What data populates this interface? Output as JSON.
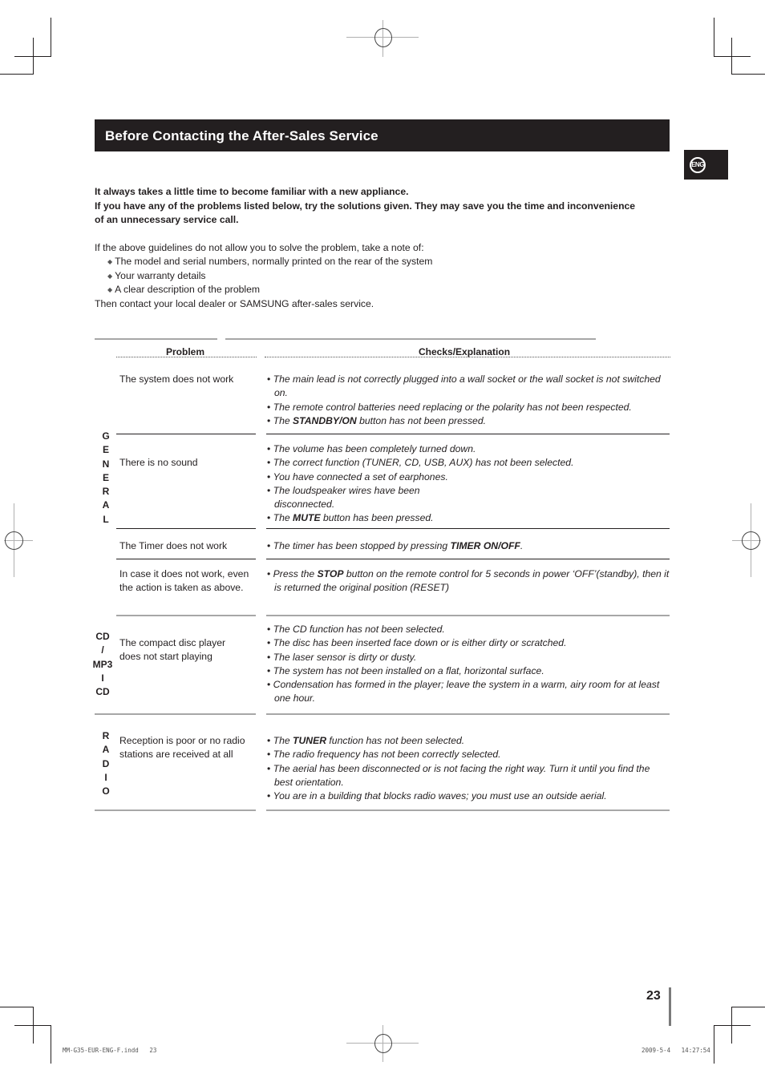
{
  "header": {
    "title": "Before Contacting the After-Sales Service",
    "language_badge": "ENG"
  },
  "intro": {
    "lines": [
      "It always takes a little time to become familiar with a new appliance.",
      "If you have any of the problems listed below, try the solutions given. They may save you the time and inconvenience of an unnecessary service call."
    ]
  },
  "notes": {
    "lead": "If the above guidelines do not allow you to solve the problem, take a note of:",
    "bullets": [
      "The model and serial numbers, normally printed on the rear of the system",
      "Your warranty details",
      "A clear description of the problem"
    ],
    "closing": "Then contact your local dealer or SAMSUNG after-sales service."
  },
  "table": {
    "columns": [
      "Problem",
      "Checks/Explanation"
    ],
    "categories": {
      "general": "G\nE\nN\nE\nR\nA\nL",
      "cd": "CD\n/\nMP3\nI\nCD",
      "radio": "R\nA\nD\nI\nO"
    },
    "rows": [
      {
        "category": "general",
        "problem": "The system does not work",
        "checks": [
          {
            "pre": "The main lead is not correctly plugged into a wall socket or the wall socket is not switched on.",
            "bold": "",
            "post": ""
          },
          {
            "pre": "The remote control batteries need replacing or the polarity has not been respected.",
            "bold": "",
            "post": ""
          },
          {
            "pre": "The ",
            "bold": "STANDBY/ON",
            "post": " button has not been pressed."
          }
        ]
      },
      {
        "category": "general",
        "problem": "There is no sound",
        "checks": [
          {
            "pre": "The volume has been completely turned down.",
            "bold": "",
            "post": ""
          },
          {
            "pre": "The correct function (TUNER, CD, USB, AUX) has not been selected.",
            "bold": "",
            "post": ""
          },
          {
            "pre": "You have connected a set of earphones.",
            "bold": "",
            "post": ""
          },
          {
            "pre": "The loudspeaker wires have been disconnected.",
            "bold": "",
            "post": ""
          },
          {
            "pre": "The ",
            "bold": "MUTE",
            "post": " button has been pressed."
          }
        ]
      },
      {
        "category": "general",
        "problem": "The Timer does not work",
        "checks": [
          {
            "pre": "The timer has been stopped by pressing ",
            "bold": "TIMER ON/OFF",
            "post": "."
          }
        ]
      },
      {
        "category": "general",
        "problem": "In case it does not work, even the action is taken as above.",
        "checks": [
          {
            "pre": "Press the ",
            "bold": "STOP",
            "post": " button on the remote control for 5 seconds in power ‘OFF’(standby), then it is returned the original position (RESET)"
          }
        ]
      },
      {
        "category": "cd",
        "problem": "The compact disc player does not start playing",
        "checks": [
          {
            "pre": "The CD function has not been selected.",
            "bold": "",
            "post": ""
          },
          {
            "pre": "The disc has been inserted face down or is either dirty or scratched.",
            "bold": "",
            "post": ""
          },
          {
            "pre": "The laser sensor is dirty or dusty.",
            "bold": "",
            "post": ""
          },
          {
            "pre": "The system has not been installed on a flat, horizontal surface.",
            "bold": "",
            "post": ""
          },
          {
            "pre": "Condensation has formed in the player; leave the system in a warm, airy room for at least one hour.",
            "bold": "",
            "post": ""
          }
        ]
      },
      {
        "category": "radio",
        "problem": "Reception is poor or no radio stations are received at all",
        "checks": [
          {
            "pre": "The ",
            "bold": "TUNER",
            "post": " function has not been selected."
          },
          {
            "pre": "The radio frequency has not been correctly selected.",
            "bold": "",
            "post": ""
          },
          {
            "pre": "The aerial has been disconnected or is not facing the right way. Turn it until you find the best orientation.",
            "bold": "",
            "post": ""
          },
          {
            "pre": "You are in a building that blocks radio waves; you must use an outside aerial.",
            "bold": "",
            "post": ""
          }
        ]
      }
    ]
  },
  "footer": {
    "page_number": "23",
    "slug_left": "MM-G35-EUR-ENG-F.indd   23",
    "slug_right": "2009-5-4   14:27:54"
  }
}
